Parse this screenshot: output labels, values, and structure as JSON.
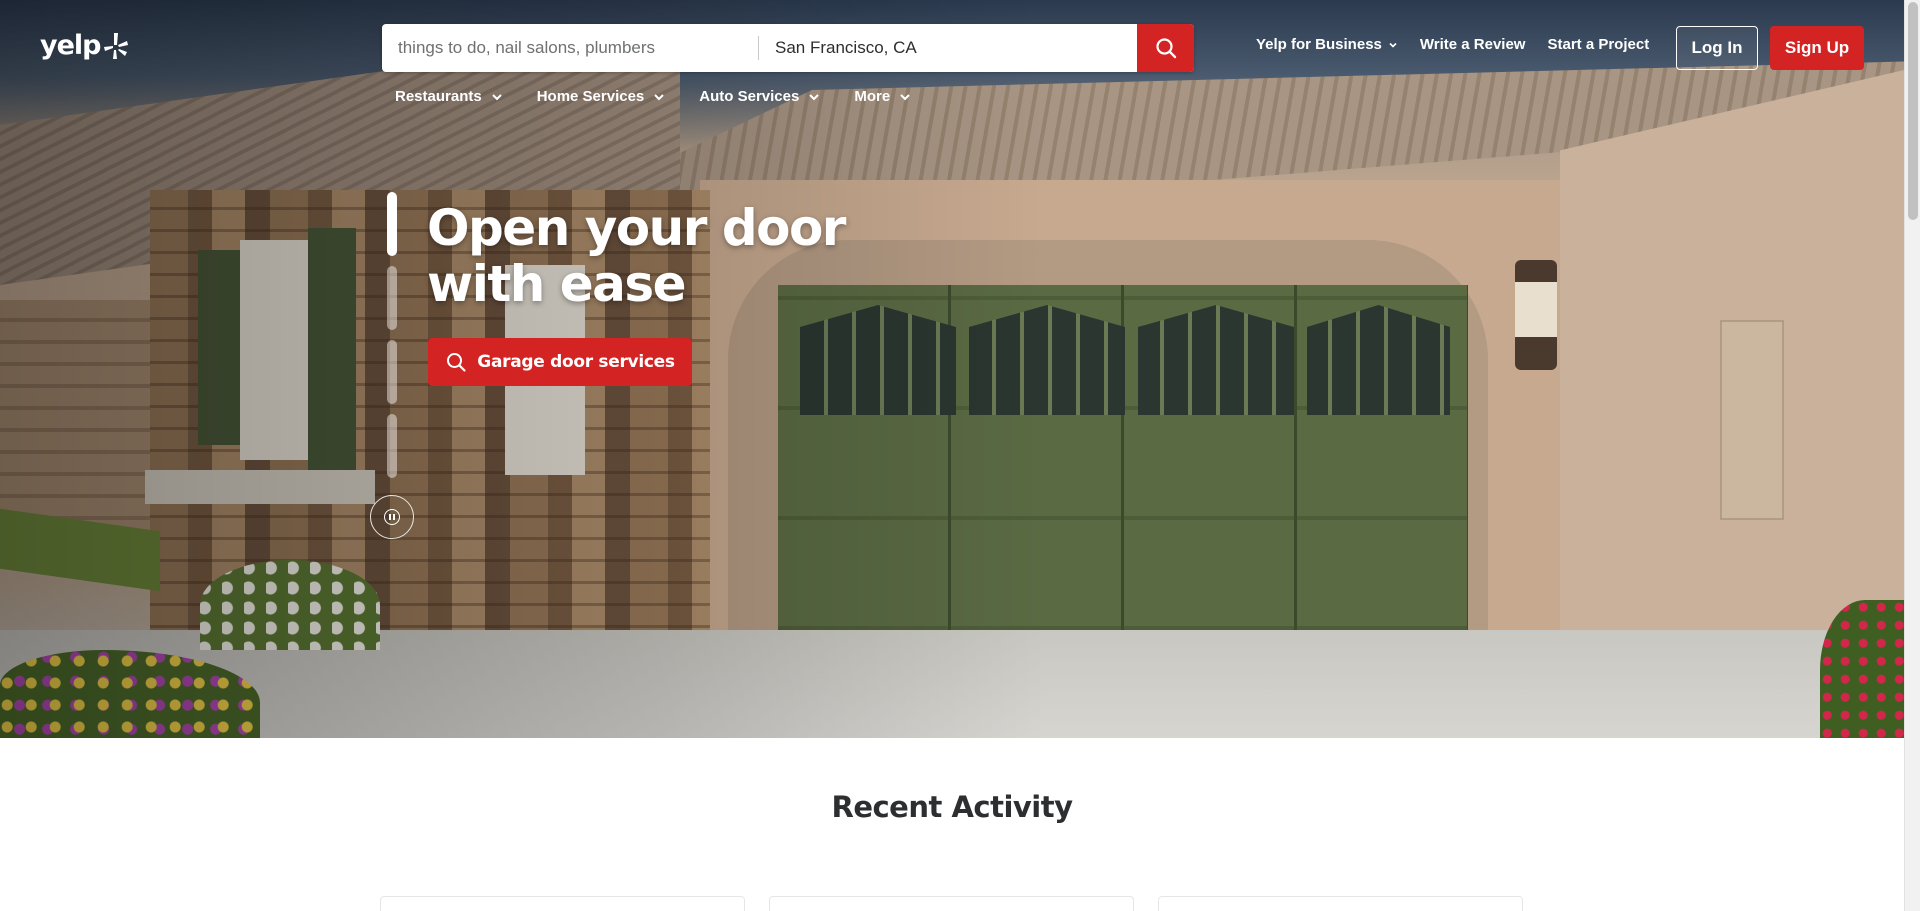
{
  "brand": {
    "logo_text": "yelp",
    "accent": "#d32323"
  },
  "search": {
    "find_placeholder": "things to do, nail salons, plumbers",
    "near_value": "San Francisco, CA",
    "submit_icon": "search-icon"
  },
  "header_links": {
    "business": "Yelp for Business",
    "write_review": "Write a Review",
    "start_project": "Start a Project",
    "login": "Log In",
    "signup": "Sign Up"
  },
  "categories": [
    {
      "label": "Restaurants"
    },
    {
      "label": "Home Services"
    },
    {
      "label": "Auto Services"
    },
    {
      "label": "More"
    }
  ],
  "hero": {
    "headline_line1": "Open your door",
    "headline_line2": "with ease",
    "cta_label": "Garage door services",
    "cta_icon": "search-icon",
    "slides_total": 4,
    "active_slide": 1
  },
  "recent_activity": {
    "title": "Recent Activity"
  }
}
